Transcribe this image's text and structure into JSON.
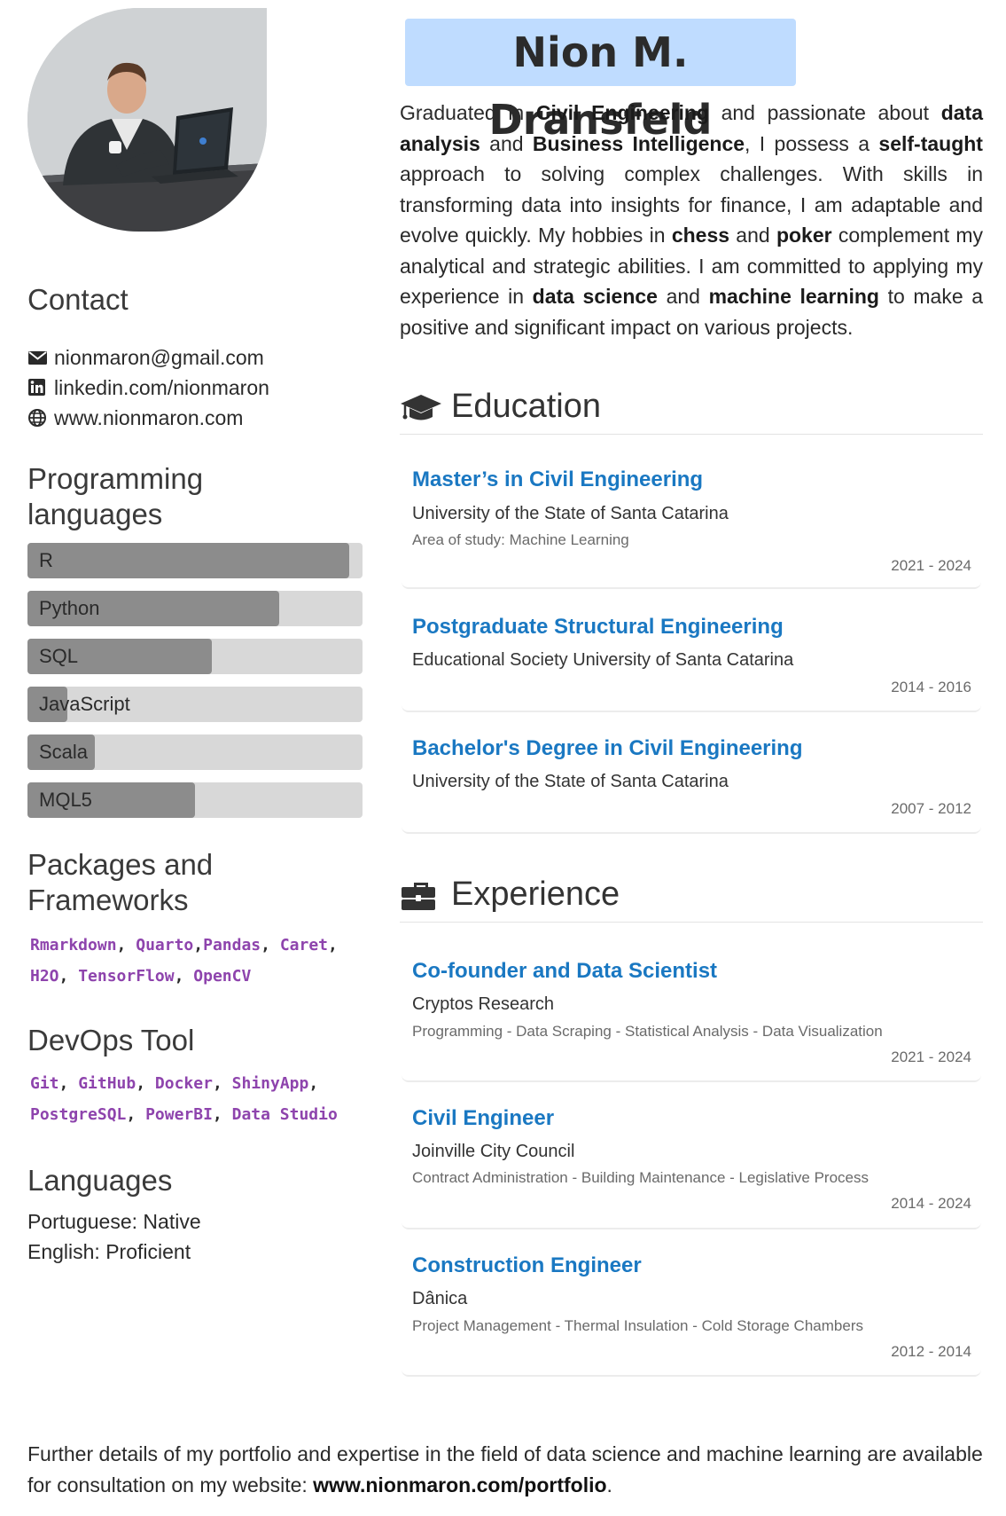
{
  "name": "Nion M. Dransfeld",
  "bio": {
    "p1": "Graduated in ",
    "b1": "Civil Engineering",
    "p2": " and passionate about ",
    "b2": "data analysis",
    "p3": " and ",
    "b3": "Business Intelligence",
    "p4": ", I possess a ",
    "b4": "self-taught",
    "p5": " approach to solving complex challenges. With skills in transforming data into insights for finance, I am adaptable and evolve quickly. My hobbies in ",
    "b5": "chess",
    "p6": " and ",
    "b6": "poker",
    "p7": " complement my analytical and strategic abilities. I am committed to applying my experience in ",
    "b7": "data science",
    "p8": " and ",
    "b8": "machine learning",
    "p9": " to make a positive and significant impact on various projects."
  },
  "contact": {
    "title": "Contact",
    "email": "nionmaron@gmail.com",
    "linkedin": "linkedin.com/nionmaron",
    "website": "www.nionmaron.com"
  },
  "programming": {
    "title": "Programming languages",
    "items": [
      {
        "label": "R",
        "level": 0.96
      },
      {
        "label": "Python",
        "level": 0.75
      },
      {
        "label": "SQL",
        "level": 0.55
      },
      {
        "label": "JavaScript",
        "level": 0.12
      },
      {
        "label": "Scala",
        "level": 0.2
      },
      {
        "label": "MQL5",
        "level": 0.5
      }
    ],
    "fill_color": "#8c8c8c",
    "track_color": "#d8d8d8"
  },
  "packages": {
    "title": "Packages and Frameworks",
    "items": [
      "Rmarkdown",
      "Quarto",
      "Pandas",
      "Caret",
      "H2O",
      "TensorFlow",
      "OpenCV"
    ]
  },
  "devops": {
    "title": "DevOps Tool",
    "items": [
      "Git",
      "GitHub",
      "Docker",
      "ShinyApp",
      "PostgreSQL",
      "PowerBI",
      "Data Studio"
    ]
  },
  "languages": {
    "title": "Languages",
    "items": [
      "Portuguese: Native",
      "English: Proficient"
    ]
  },
  "education": {
    "title": "Education",
    "icon": "graduation-cap-icon",
    "entries": [
      {
        "title": "Master’s in Civil Engineering",
        "org": "University of the State of Santa Catarina",
        "detail": "Area of study: Machine Learning",
        "years": "2021 - 2024"
      },
      {
        "title": "Postgraduate Structural Engineering",
        "org": "Educational Society University of Santa Catarina",
        "detail": "",
        "years": "2014 - 2016"
      },
      {
        "title": "Bachelor's Degree in Civil Engineering",
        "org": "University of the State of Santa Catarina",
        "detail": "",
        "years": "2007 - 2012"
      }
    ]
  },
  "experience": {
    "title": "Experience",
    "icon": "briefcase-icon",
    "entries": [
      {
        "title": "Co-founder and Data Scientist",
        "org": "Cryptos Research",
        "detail": "Programming - Data Scraping - Statistical Analysis - Data Visualization",
        "years": "2021 - 2024"
      },
      {
        "title": "Civil Engineer",
        "org": "Joinville City Council",
        "detail": "Contract Administration - Building Maintenance - Legislative Process",
        "years": "2014 - 2024"
      },
      {
        "title": "Construction Engineer",
        "org": "Dânica",
        "detail": "Project Management - Thermal Insulation - Cold Storage Chambers",
        "years": "2012 - 2014"
      }
    ]
  },
  "footer": {
    "text": "Further details of my portfolio and expertise in the field of data science and machine learning are available for consultation on my website: ",
    "link": "www.nionmaron.com/portfolio",
    "end": "."
  },
  "colors": {
    "name_bg": "#bfdcff",
    "title_blue": "#1a78c2",
    "code_purple": "#8e44ad"
  }
}
